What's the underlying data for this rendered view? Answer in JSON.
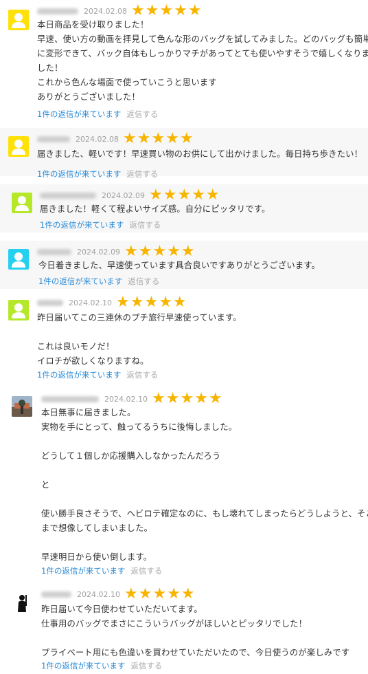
{
  "reviews": [
    {
      "avatar": "yellow-user-icon",
      "avatar_color": "#ffe10a",
      "date": "2024.02.08",
      "stars": 5,
      "lines": [
        "本日商品を受け取りました！",
        "早速、使い方の動画を拝見して色んな形のバッグを試してみました。どのバッグも簡単",
        "に変形できて、バック自体もしっかりマチがあってとても使いやすそうで嬉しくなりま",
        "した！",
        "これから色んな場面で使っていこうと思います",
        "ありがとうございました！"
      ],
      "reply_count": "1件の返信が来ています",
      "reply_label": "返信する"
    },
    {
      "avatar": "yellow-user-icon",
      "avatar_color": "#ffe10a",
      "date": "2024.02.08",
      "stars": 5,
      "lines": [
        "届きました、軽いです！早速買い物のお供にして出かけました。毎日持ち歩きたい！"
      ],
      "reply_count": "1件の返信が来ています",
      "reply_label": "返信する"
    },
    {
      "avatar": "green-user-icon",
      "avatar_color": "#b6e82a",
      "date": "2024.02.09",
      "stars": 5,
      "lines": [
        "届きました！軽くて程よいサイズ感。自分にピッタリです。"
      ],
      "reply_count": "1件の返信が来ています",
      "reply_label": "返信する"
    },
    {
      "avatar": "cyan-user-icon",
      "avatar_color": "#26d0ef",
      "date": "2024.02.09",
      "stars": 5,
      "lines": [
        "今日着きました、早速使っています具合良いですありがとうございます。"
      ],
      "reply_count": "1件の返信が来ています",
      "reply_label": "返信する"
    },
    {
      "avatar": "green-user-icon",
      "avatar_color": "#b6e82a",
      "date": "2024.02.10",
      "stars": 5,
      "lines": [
        "昨日届いてこの三連休のプチ旅行早速使っています。",
        "",
        "これは良いモノだ！",
        "イロチが欲しくなりますね。"
      ],
      "reply_count": "1件の返信が来ています",
      "reply_label": "返信する"
    },
    {
      "avatar": "photo-avatar",
      "avatar_color": "#7a8fa8",
      "date": "2024.02.10",
      "stars": 5,
      "lines": [
        "本日無事に届きました。",
        "実物を手にとって、触ってるうちに後悔しました。",
        "",
        "どうして１個しか応援購入しなかったんだろう",
        "",
        "と",
        "",
        "使い勝手良さそうで、ヘビロテ確定なのに、もし壊れてしまったらどうしようと、そこ",
        "まで想像してしまいました。",
        "",
        "早速明日から使い倒します。"
      ],
      "reply_count": "1件の返信が来ています",
      "reply_label": "返信する"
    },
    {
      "avatar": "silhouette-avatar",
      "avatar_color": "#111111",
      "date": "2024.02.10",
      "stars": 5,
      "lines": [
        "昨日届いて今日使わせていただいてます。",
        "仕事用のバッグでまさにこういうバッグがほしいとピッタリでした！",
        "",
        "プライベート用にも色違いを買わせていただいたので、今日使うのが楽しみです"
      ],
      "reply_count": "1件の返信が来ています",
      "reply_label": "返信する"
    }
  ]
}
